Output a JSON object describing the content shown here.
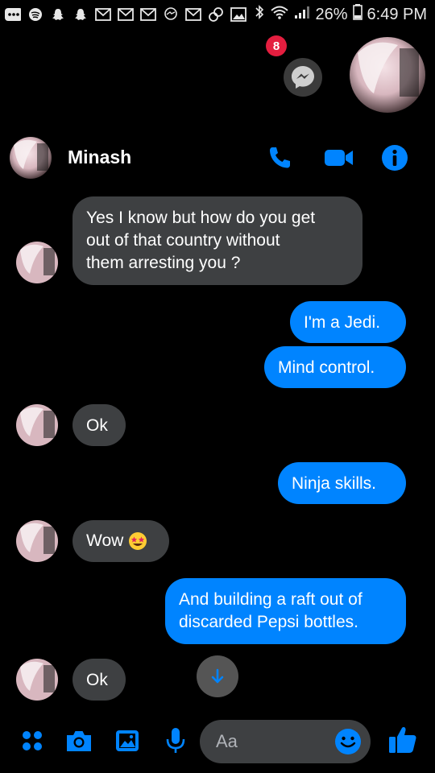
{
  "status_bar": {
    "battery": "26%",
    "time": "6:49 PM",
    "icons": [
      "more-icon",
      "spotify-icon",
      "snapchat-icon",
      "snapchat-icon",
      "gmail-icon",
      "mail-icon",
      "mail-icon",
      "messenger-icon",
      "mail-icon",
      "link-icon",
      "image-icon",
      "bluetooth-icon",
      "wifi-icon",
      "signal-icon",
      "battery-icon"
    ]
  },
  "chat_heads": {
    "badge_count": "8"
  },
  "header": {
    "contact_name": "Minash",
    "icons": [
      "phone-icon",
      "video-icon",
      "info-icon"
    ]
  },
  "messages": [
    {
      "sender": "Minash",
      "text": "Yes I know but how do you get\nout of that country without\nthem arresting you ?"
    },
    {
      "sender": "me",
      "text": "I'm a Jedi."
    },
    {
      "sender": "me",
      "text": "Mind control."
    },
    {
      "sender": "Minash",
      "text": "Ok"
    },
    {
      "sender": "me",
      "text": "Ninja skills."
    },
    {
      "sender": "Minash",
      "text": "Wow",
      "emoji": "star-struck-emoji"
    },
    {
      "sender": "me",
      "text": "And building a raft out of\ndiscarded Pepsi bottles."
    },
    {
      "sender": "Minash",
      "text": "Ok"
    }
  ],
  "composer": {
    "placeholder": "Aa",
    "icons": [
      "menu-dots-icon",
      "camera-icon",
      "gallery-icon",
      "microphone-icon",
      "emoji-icon",
      "thumbs-up-icon"
    ]
  },
  "colors": {
    "accent": "#0084ff",
    "received_bubble": "#3e4042",
    "background": "#000000",
    "badge": "#e41e3f"
  }
}
